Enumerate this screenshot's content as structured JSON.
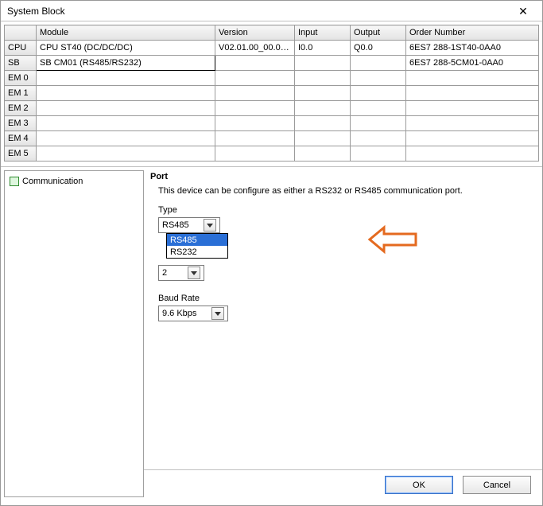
{
  "window": {
    "title": "System Block"
  },
  "grid": {
    "headers": {
      "slot": "",
      "module": "Module",
      "version": "Version",
      "input": "Input",
      "output": "Output",
      "order": "Order Number"
    },
    "rows": [
      {
        "slot": "CPU",
        "module": "CPU ST40 (DC/DC/DC)",
        "version": "V02.01.00_00.00...",
        "input": "I0.0",
        "output": "Q0.0",
        "order": "6ES7 288-1ST40-0AA0"
      },
      {
        "slot": "SB",
        "module": "SB CM01 (RS485/RS232)",
        "version": "",
        "input": "",
        "output": "",
        "order": "6ES7 288-5CM01-0AA0"
      },
      {
        "slot": "EM 0",
        "module": "",
        "version": "",
        "input": "",
        "output": "",
        "order": ""
      },
      {
        "slot": "EM 1",
        "module": "",
        "version": "",
        "input": "",
        "output": "",
        "order": ""
      },
      {
        "slot": "EM 2",
        "module": "",
        "version": "",
        "input": "",
        "output": "",
        "order": ""
      },
      {
        "slot": "EM 3",
        "module": "",
        "version": "",
        "input": "",
        "output": "",
        "order": ""
      },
      {
        "slot": "EM 4",
        "module": "",
        "version": "",
        "input": "",
        "output": "",
        "order": ""
      },
      {
        "slot": "EM 5",
        "module": "",
        "version": "",
        "input": "",
        "output": "",
        "order": ""
      }
    ]
  },
  "tree": {
    "items": [
      {
        "label": "Communication"
      }
    ]
  },
  "port": {
    "heading": "Port",
    "desc": "This device can be configure as either a RS232 or RS485 communication port.",
    "type_label": "Type",
    "type_value": "RS485",
    "type_options": [
      "RS485",
      "RS232"
    ],
    "addr_value": "2",
    "baud_label": "Baud Rate",
    "baud_value": "9.6 Kbps"
  },
  "buttons": {
    "ok": "OK",
    "cancel": "Cancel"
  }
}
